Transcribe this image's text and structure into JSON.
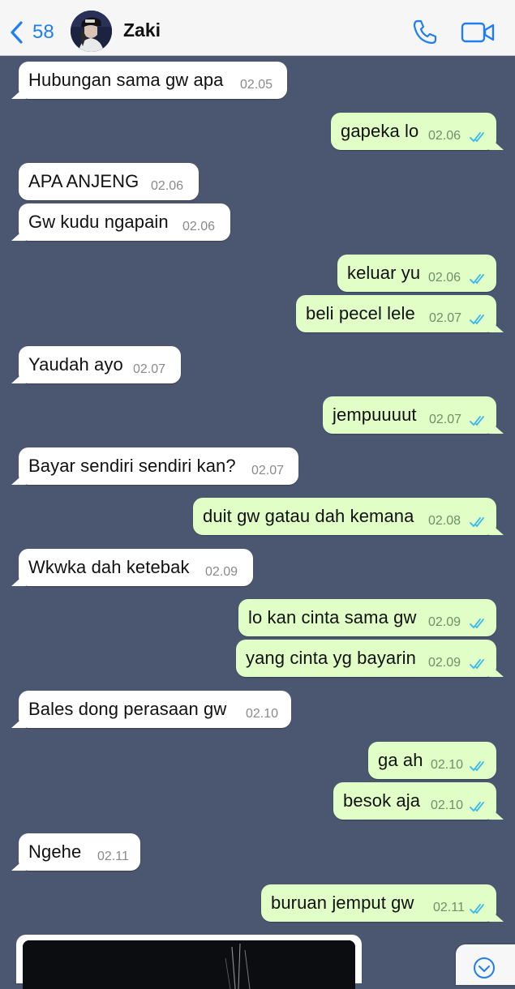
{
  "header": {
    "back_count": "58",
    "contact_name": "Zaki"
  },
  "colors": {
    "chat_background": "#4b5670",
    "incoming_bubble": "#ffffff",
    "outgoing_bubble": "#e1fec6",
    "accent": "#1f7ef0",
    "read_ticks": "#34b7f1"
  },
  "messages": [
    {
      "dir": "in",
      "text": "Hubungan sama gw apa",
      "time": "02.05"
    },
    {
      "dir": "out",
      "text": "gapeka lo",
      "time": "02.06",
      "status": "read"
    },
    {
      "dir": "in",
      "text": "APA ANJENG",
      "time": "02.06"
    },
    {
      "dir": "in",
      "text": "Gw kudu ngapain",
      "time": "02.06"
    },
    {
      "dir": "out",
      "text": "keluar yu",
      "time": "02.06",
      "status": "read"
    },
    {
      "dir": "out",
      "text": "beli pecel lele",
      "time": "02.07",
      "status": "read"
    },
    {
      "dir": "in",
      "text": "Yaudah ayo",
      "time": "02.07"
    },
    {
      "dir": "out",
      "text": "jempuuuut",
      "time": "02.07",
      "status": "read"
    },
    {
      "dir": "in",
      "text": "Bayar sendiri sendiri kan?",
      "time": "02.07"
    },
    {
      "dir": "out",
      "text": "duit gw gatau dah kemana",
      "time": "02.08",
      "status": "read"
    },
    {
      "dir": "in",
      "text": "Wkwka dah ketebak",
      "time": "02.09"
    },
    {
      "dir": "out",
      "text": "lo kan cinta sama gw",
      "time": "02.09",
      "status": "read"
    },
    {
      "dir": "out",
      "text": "yang cinta yg bayarin",
      "time": "02.09",
      "status": "read"
    },
    {
      "dir": "in",
      "text": "Bales dong perasaan gw",
      "time": "02.10"
    },
    {
      "dir": "out",
      "text": "ga ah",
      "time": "02.10",
      "status": "read"
    },
    {
      "dir": "out",
      "text": "besok aja",
      "time": "02.10",
      "status": "read"
    },
    {
      "dir": "in",
      "text": "Ngehe",
      "time": "02.11"
    },
    {
      "dir": "out",
      "text": "buruan jemput gw",
      "time": "02.11",
      "status": "read"
    }
  ],
  "icons": {
    "back": "chevron-left-icon",
    "call": "phone-icon",
    "video": "video-camera-icon",
    "read_status": "double-check-icon",
    "scroll_down": "chevron-down-circle-icon"
  }
}
